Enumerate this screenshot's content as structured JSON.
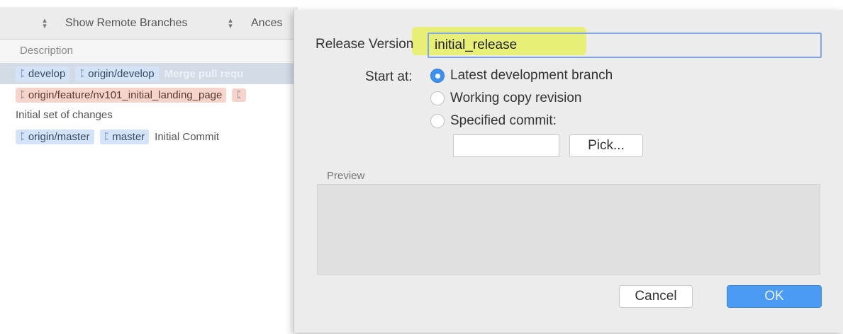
{
  "toolbar": {
    "show_remote_branches": "Show Remote Branches",
    "ancestor": "Ances"
  },
  "history": {
    "column_header": "Description",
    "rows": [
      {
        "tags": [
          "develop",
          "origin/develop"
        ],
        "message": "Merge pull requ"
      },
      {
        "tags": [
          "origin/feature/nv101_initial_landing_page"
        ],
        "message": ""
      },
      {
        "tags": [],
        "message": "Initial set of changes"
      },
      {
        "tags": [
          "origin/master",
          "master"
        ],
        "message": "Initial Commit"
      }
    ],
    "branch_glyph": "ᛈ"
  },
  "dialog": {
    "release_version_label": "Release Version",
    "release_version_value": "initial_release",
    "start_at_label": "Start at:",
    "options": [
      {
        "label": "Latest development branch",
        "selected": true
      },
      {
        "label": "Working copy revision",
        "selected": false
      },
      {
        "label": "Specified commit:",
        "selected": false
      }
    ],
    "specified_commit_value": "",
    "pick_button": "Pick...",
    "preview_label": "Preview",
    "cancel_button": "Cancel",
    "ok_button": "OK"
  },
  "colors": {
    "accent": "#3d8ff0",
    "highlight": "#e8f06a",
    "tag_blue": "#d4e3f7",
    "tag_red": "#f6d4cc"
  }
}
